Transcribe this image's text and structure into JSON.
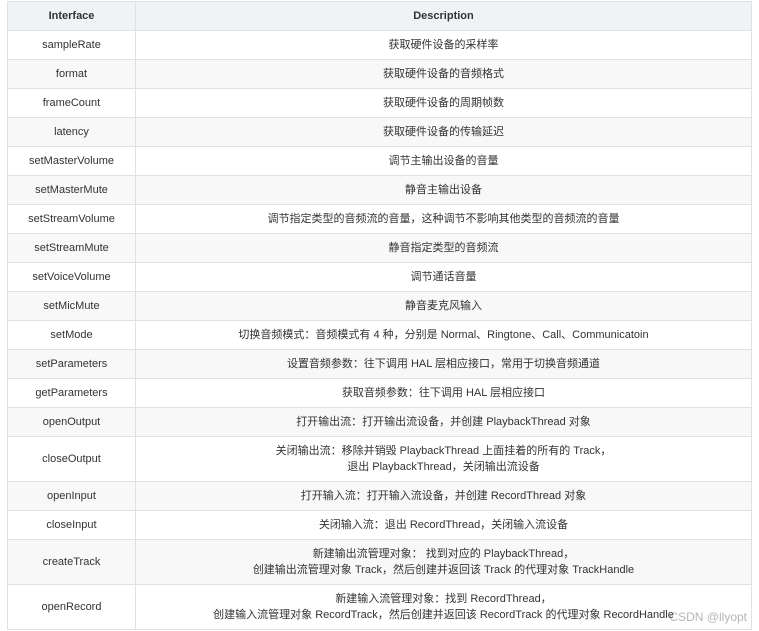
{
  "table": {
    "headers": [
      "Interface",
      "Description"
    ],
    "rows": [
      {
        "interface": "sampleRate",
        "desc": [
          "获取硬件设备的采样率"
        ]
      },
      {
        "interface": "format",
        "desc": [
          "获取硬件设备的音频格式"
        ]
      },
      {
        "interface": "frameCount",
        "desc": [
          "获取硬件设备的周期帧数"
        ]
      },
      {
        "interface": "latency",
        "desc": [
          "获取硬件设备的传输延迟"
        ]
      },
      {
        "interface": "setMasterVolume",
        "desc": [
          "调节主输出设备的音量"
        ]
      },
      {
        "interface": "setMasterMute",
        "desc": [
          "静音主输出设备"
        ]
      },
      {
        "interface": "setStreamVolume",
        "desc": [
          "调节指定类型的音频流的音量，这种调节不影响其他类型的音频流的音量"
        ]
      },
      {
        "interface": "setStreamMute",
        "desc": [
          "静音指定类型的音频流"
        ]
      },
      {
        "interface": "setVoiceVolume",
        "desc": [
          "调节通话音量"
        ]
      },
      {
        "interface": "setMicMute",
        "desc": [
          "静音麦克风输入"
        ]
      },
      {
        "interface": "setMode",
        "desc": [
          "切换音频模式：音频模式有 4 种，分别是 Normal、Ringtone、Call、Communicatoin"
        ]
      },
      {
        "interface": "setParameters",
        "desc": [
          "设置音频参数：往下调用 HAL 层相应接口，常用于切换音频通道"
        ]
      },
      {
        "interface": "getParameters",
        "desc": [
          "获取音频参数：往下调用 HAL 层相应接口"
        ]
      },
      {
        "interface": "openOutput",
        "desc": [
          "打开输出流：打开输出流设备，并创建 PlaybackThread 对象"
        ]
      },
      {
        "interface": "closeOutput",
        "desc": [
          "关闭输出流：移除并销毁 PlaybackThread 上面挂着的所有的 Track，",
          "退出 PlaybackThread，关闭输出流设备"
        ]
      },
      {
        "interface": "openInput",
        "desc": [
          "打开输入流：打开输入流设备，并创建 RecordThread 对象"
        ]
      },
      {
        "interface": "closeInput",
        "desc": [
          "关闭输入流：退出 RecordThread，关闭输入流设备"
        ]
      },
      {
        "interface": "createTrack",
        "desc": [
          "新建输出流管理对象： 找到对应的 PlaybackThread，",
          "创建输出流管理对象 Track，然后创建并返回该 Track 的代理对象 TrackHandle"
        ]
      },
      {
        "interface": "openRecord",
        "desc": [
          "新建输入流管理对象：找到 RecordThread，",
          "创建输入流管理对象 RecordTrack，然后创建并返回该 RecordTrack 的代理对象 RecordHandle"
        ]
      }
    ]
  },
  "watermark": "CSDN @llyopt"
}
